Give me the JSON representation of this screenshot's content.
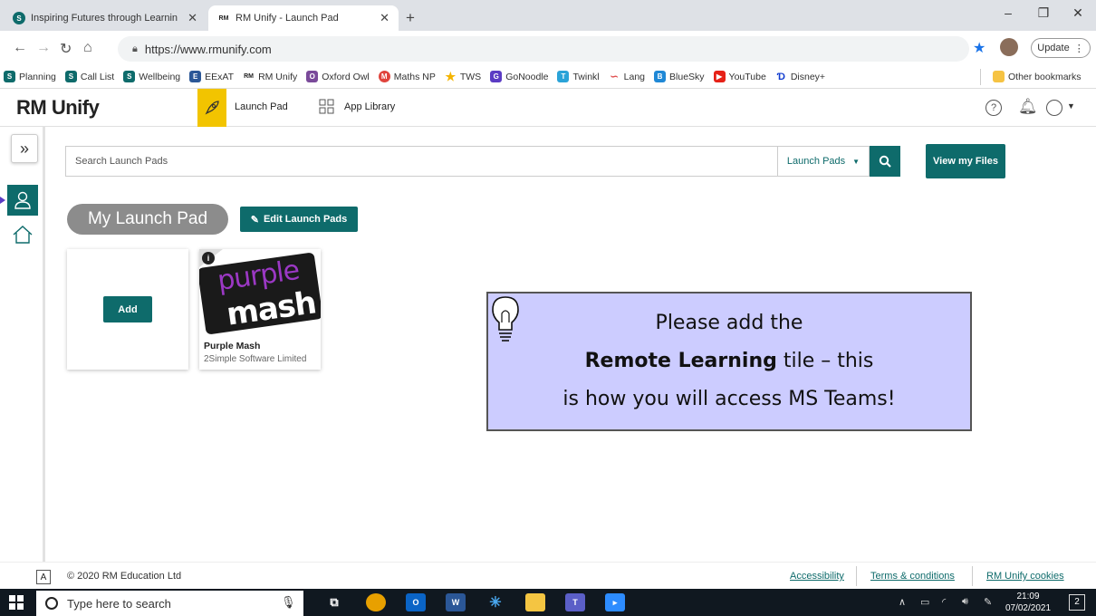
{
  "browser": {
    "tabs": [
      {
        "title": "Inspiring Futures through Learnin",
        "active": false
      },
      {
        "title": "RM Unify - Launch Pad",
        "active": true
      }
    ],
    "new_tab": "+",
    "window_controls": {
      "minimize": "–",
      "maximize": "❐",
      "close": "✕"
    },
    "url": "https://www.rmunify.com",
    "update_label": "Update",
    "bookmarks": [
      {
        "label": "Planning",
        "icon": "s-icon",
        "color": "#0e6b6b"
      },
      {
        "label": "Call List",
        "icon": "s-icon",
        "color": "#0e6b6b"
      },
      {
        "label": "Wellbeing",
        "icon": "s-icon",
        "color": "#0e6b6b"
      },
      {
        "label": "EExAT",
        "icon": "eexat-icon",
        "color": "#2b5797"
      },
      {
        "label": "RM Unify",
        "icon": "rm-icon",
        "color": "#222222"
      },
      {
        "label": "Oxford Owl",
        "icon": "owl-icon",
        "color": "#7a4a9a"
      },
      {
        "label": "Maths NP",
        "icon": "maths-icon",
        "color": "#e0443c"
      },
      {
        "label": "TWS",
        "icon": "star-icon",
        "color": "#f4b400"
      },
      {
        "label": "GoNoodle",
        "icon": "go-icon",
        "color": "#5b3cc4"
      },
      {
        "label": "Twinkl",
        "icon": "twinkl-icon",
        "color": "#2aa3d8"
      },
      {
        "label": "Lang",
        "icon": "lang-icon",
        "color": "#e05050"
      },
      {
        "label": "BlueSky",
        "icon": "bluesky-icon",
        "color": "#1f88d6"
      },
      {
        "label": "YouTube",
        "icon": "youtube-icon",
        "color": "#e62117"
      },
      {
        "label": "Disney+",
        "icon": "disney-icon",
        "color": "#113ccf"
      }
    ],
    "other_bookmarks": "Other bookmarks"
  },
  "app": {
    "logo": "RM Unify",
    "nav": {
      "launch_pad": "Launch Pad",
      "app_library": "App Library"
    },
    "search": {
      "placeholder": "Search Launch Pads",
      "scope": "Launch Pads"
    },
    "view_files": "View my Files",
    "my_launch_pad": "My Launch Pad",
    "edit_launch_pads": "Edit Launch Pads",
    "add_label": "Add",
    "tiles": [
      {
        "name": "Purple Mash",
        "vendor": "2Simple Software Limited",
        "logo_top": "purple",
        "logo_bottom": "mash",
        "info": "i"
      }
    ]
  },
  "callout": {
    "line1": "Please add the",
    "line2_bold": "Remote Learning",
    "line2_rest": " tile – this",
    "line3": "is how you will access MS Teams!"
  },
  "footer": {
    "a_label": "A",
    "copyright": "© 2020 RM Education Ltd",
    "links": [
      "Accessibility",
      "Terms & conditions",
      "RM Unify cookies"
    ]
  },
  "taskbar": {
    "search_placeholder": "Type here to search",
    "time": "21:09",
    "date": "07/02/2021",
    "notifications": "2"
  },
  "colors": {
    "accent": "#0e6b6b",
    "launchpad_tab": "#f2c400",
    "callout_bg": "#ccccff"
  }
}
